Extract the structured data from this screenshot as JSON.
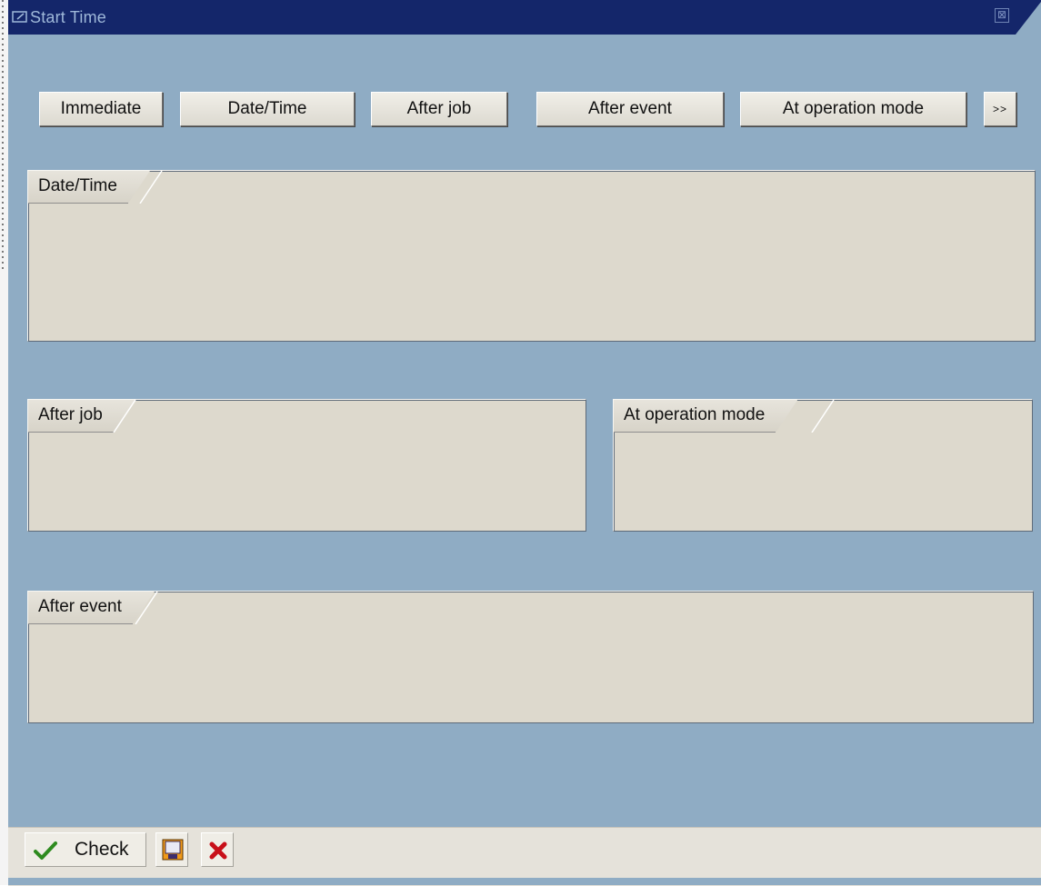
{
  "window": {
    "title": "Start Time",
    "close_label": "⊠"
  },
  "toolbar": {
    "buttons": [
      {
        "label": "Immediate"
      },
      {
        "label": "Date/Time"
      },
      {
        "label": "After job"
      },
      {
        "label": "After event"
      },
      {
        "label": "At operation mode"
      },
      {
        "label": ">>"
      }
    ]
  },
  "groups": {
    "date_time": {
      "title": "Date/Time"
    },
    "after_job": {
      "title": "After job"
    },
    "at_operation_mode": {
      "title": "At operation mode"
    },
    "after_event": {
      "title": "After event"
    }
  },
  "footer": {
    "check_label": "Check",
    "icons": {
      "check": "checkmark-icon",
      "save": "save-icon",
      "cancel": "cancel-icon"
    }
  },
  "colors": {
    "titlebar": "#14266a",
    "window_bg": "#8facc4",
    "panel_bg": "#ddd9cd",
    "check_green": "#2e8b1f",
    "cancel_red": "#c8101a"
  }
}
